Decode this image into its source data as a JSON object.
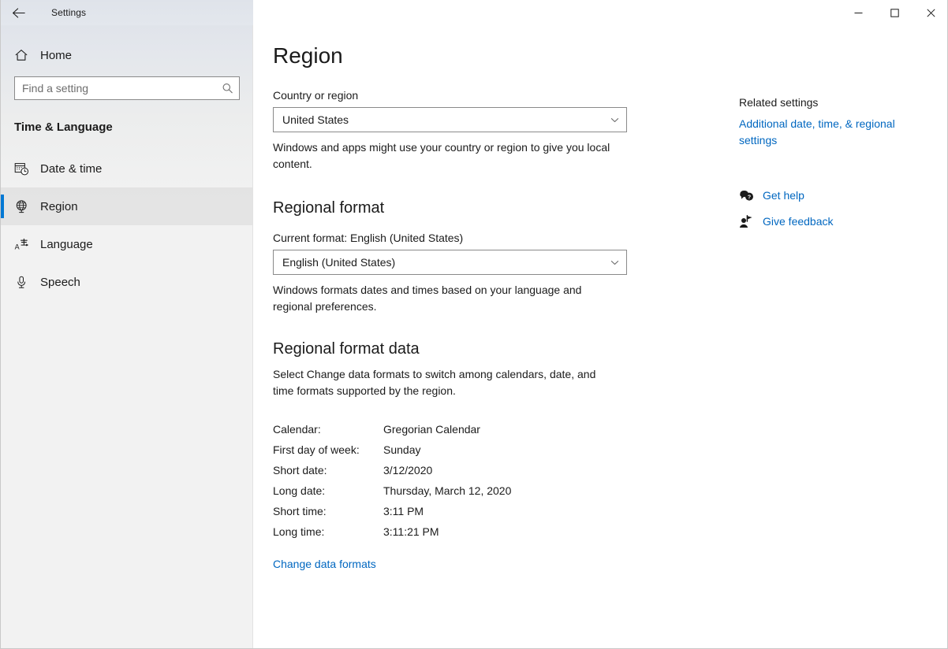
{
  "window": {
    "app_title": "Settings",
    "back_icon": "back-arrow-icon",
    "minimize_label": "─",
    "maximize_label": "☐",
    "close_label": "✕"
  },
  "sidebar": {
    "home_label": "Home",
    "home_icon": "home-icon",
    "search": {
      "placeholder": "Find a setting",
      "value": "",
      "icon": "search-icon"
    },
    "category_title": "Time & Language",
    "items": [
      {
        "label": "Date & time",
        "icon": "calendar-clock-icon",
        "selected": false
      },
      {
        "label": "Region",
        "icon": "globe-icon",
        "selected": true
      },
      {
        "label": "Language",
        "icon": "language-icon",
        "selected": false
      },
      {
        "label": "Speech",
        "icon": "microphone-icon",
        "selected": false
      }
    ]
  },
  "main": {
    "page_title": "Region",
    "country": {
      "label": "Country or region",
      "value": "United States",
      "chevron_icon": "chevron-down-icon",
      "description": "Windows and apps might use your country or region to give you local content."
    },
    "regional_format": {
      "heading": "Regional format",
      "current_label": "Current format: English (United States)",
      "value": "English (United States)",
      "chevron_icon": "chevron-down-icon",
      "description": "Windows formats dates and times based on your language and regional preferences."
    },
    "regional_format_data": {
      "heading": "Regional format data",
      "description": "Select Change data formats to switch among calendars, date, and time formats supported by the region.",
      "rows": [
        {
          "key": "Calendar:",
          "value": "Gregorian Calendar"
        },
        {
          "key": "First day of week:",
          "value": "Sunday"
        },
        {
          "key": "Short date:",
          "value": "3/12/2020"
        },
        {
          "key": "Long date:",
          "value": "Thursday, March 12, 2020"
        },
        {
          "key": "Short time:",
          "value": "3:11 PM"
        },
        {
          "key": "Long time:",
          "value": "3:11:21 PM"
        }
      ],
      "change_link": "Change data formats"
    }
  },
  "rail": {
    "heading": "Related settings",
    "link": "Additional date, time, & regional settings",
    "actions": [
      {
        "label": "Get help",
        "icon": "help-bubble-icon"
      },
      {
        "label": "Give feedback",
        "icon": "feedback-person-icon"
      }
    ]
  },
  "colors": {
    "accent": "#0078d4",
    "link": "#0067c0",
    "text": "#1b1b1b",
    "sidebar_bg": "#f2f2f2"
  }
}
